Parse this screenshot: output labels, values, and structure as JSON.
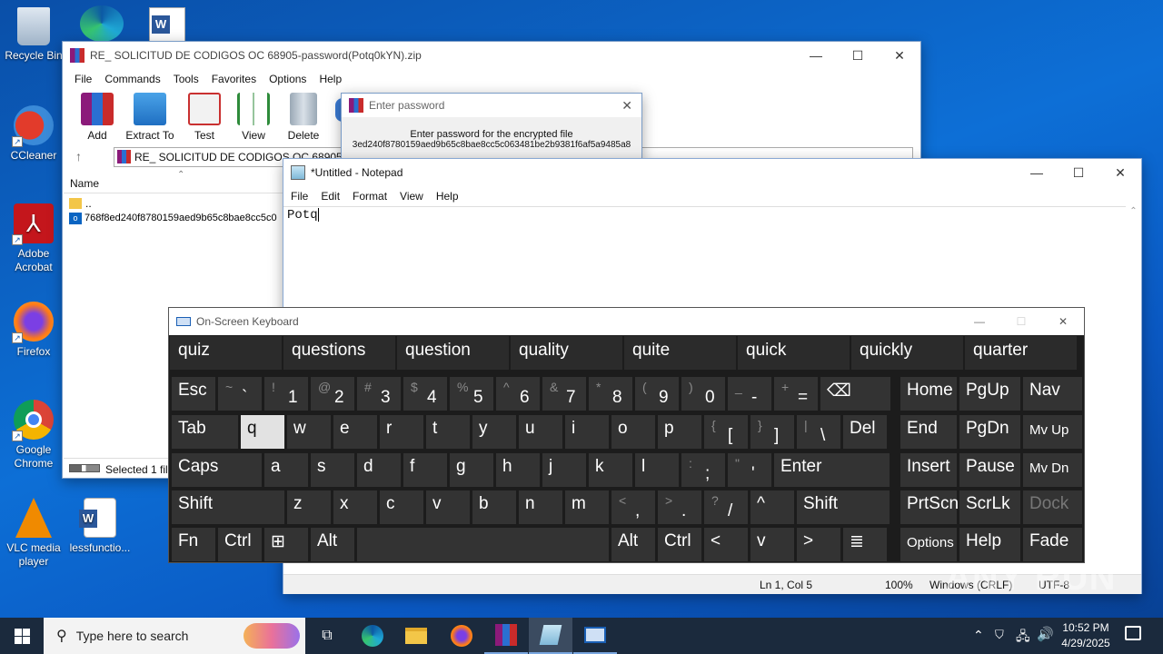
{
  "desktop": {
    "icons": [
      {
        "label": "Recycle Bin"
      },
      {
        "label": "CCleaner"
      },
      {
        "label": "Adobe Acrobat"
      },
      {
        "label": "Firefox"
      },
      {
        "label": "Google Chrome"
      },
      {
        "label": "VLC media player"
      },
      {
        "label": "lessfunctio..."
      }
    ]
  },
  "winrar": {
    "title": "RE_ SOLICITUD DE CODIGOS OC 68905-password(Potq0kYN).zip",
    "menu": [
      "File",
      "Commands",
      "Tools",
      "Favorites",
      "Options",
      "Help"
    ],
    "toolbar": [
      "Add",
      "Extract To",
      "Test",
      "View",
      "Delete"
    ],
    "path": "RE_ SOLICITUD DE CODIGOS OC 68905",
    "column_name": "Name",
    "files": [
      "..",
      "768f8ed240f8780159aed9b65c8bae8cc5c0"
    ],
    "status": "Selected 1 file"
  },
  "password_dialog": {
    "title": "Enter password",
    "prompt": "Enter password for the encrypted file",
    "filename": "3ed240f8780159aed9b65c8bae8cc5c063481be2b9381f6af5a9485a8"
  },
  "notepad": {
    "title": "*Untitled - Notepad",
    "menu": [
      "File",
      "Edit",
      "Format",
      "View",
      "Help"
    ],
    "content": "Potq",
    "status": {
      "position": "Ln 1, Col 5",
      "zoom": "100%",
      "eol": "Windows (CRLF)",
      "encoding": "UTF-8"
    }
  },
  "osk": {
    "title": "On-Screen Keyboard",
    "predictions": [
      "quiz",
      "questions",
      "question",
      "quality",
      "quite",
      "quick",
      "quickly",
      "quarter"
    ],
    "row1": [
      {
        "t": "Esc"
      },
      {
        "s": "~",
        "b": "`"
      },
      {
        "s": "!",
        "b": "1"
      },
      {
        "s": "@",
        "b": "2"
      },
      {
        "s": "#",
        "b": "3"
      },
      {
        "s": "$",
        "b": "4"
      },
      {
        "s": "%",
        "b": "5"
      },
      {
        "s": "^",
        "b": "6"
      },
      {
        "s": "&",
        "b": "7"
      },
      {
        "s": "*",
        "b": "8"
      },
      {
        "s": "(",
        "b": "9"
      },
      {
        "s": ")",
        "b": "0"
      },
      {
        "s": "_",
        "b": "-"
      },
      {
        "s": "+",
        "b": "="
      },
      {
        "t": "⌫"
      }
    ],
    "row2": [
      "Tab",
      "q",
      "w",
      "e",
      "r",
      "t",
      "y",
      "u",
      "i",
      "o",
      "p"
    ],
    "row2_extra": [
      {
        "s": "{",
        "b": "["
      },
      {
        "s": "}",
        "b": "]"
      },
      {
        "s": "|",
        "b": "\\"
      },
      {
        "t": "Del"
      }
    ],
    "row3": [
      "Caps",
      "a",
      "s",
      "d",
      "f",
      "g",
      "h",
      "j",
      "k",
      "l"
    ],
    "row3_extra": [
      {
        "s": ":",
        "b": ";"
      },
      {
        "s": "\"",
        "b": "'"
      },
      {
        "t": "Enter"
      }
    ],
    "row4": [
      "Shift",
      "z",
      "x",
      "c",
      "v",
      "b",
      "n",
      "m"
    ],
    "row4_extra": [
      {
        "s": "<",
        "b": ","
      },
      {
        "s": ">",
        "b": "."
      },
      {
        "s": "?",
        "b": "/"
      },
      {
        "t": "^"
      },
      {
        "t": "Shift"
      }
    ],
    "row5": [
      "Fn",
      "Ctrl",
      "⊞",
      "Alt",
      "",
      "Alt",
      "Ctrl",
      "<",
      "v",
      ">",
      "≣"
    ],
    "nav": [
      [
        "Home",
        "PgUp",
        "Nav"
      ],
      [
        "End",
        "PgDn",
        "Mv Up"
      ],
      [
        "Insert",
        "Pause",
        "Mv Dn"
      ],
      [
        "PrtScn",
        "ScrLk",
        "Dock"
      ],
      [
        "Options",
        "Help",
        "Fade"
      ]
    ]
  },
  "taskbar": {
    "search_placeholder": "Type here to search",
    "time": "10:52 PM",
    "date": "4/29/2025"
  },
  "watermark": "ANY RUN"
}
